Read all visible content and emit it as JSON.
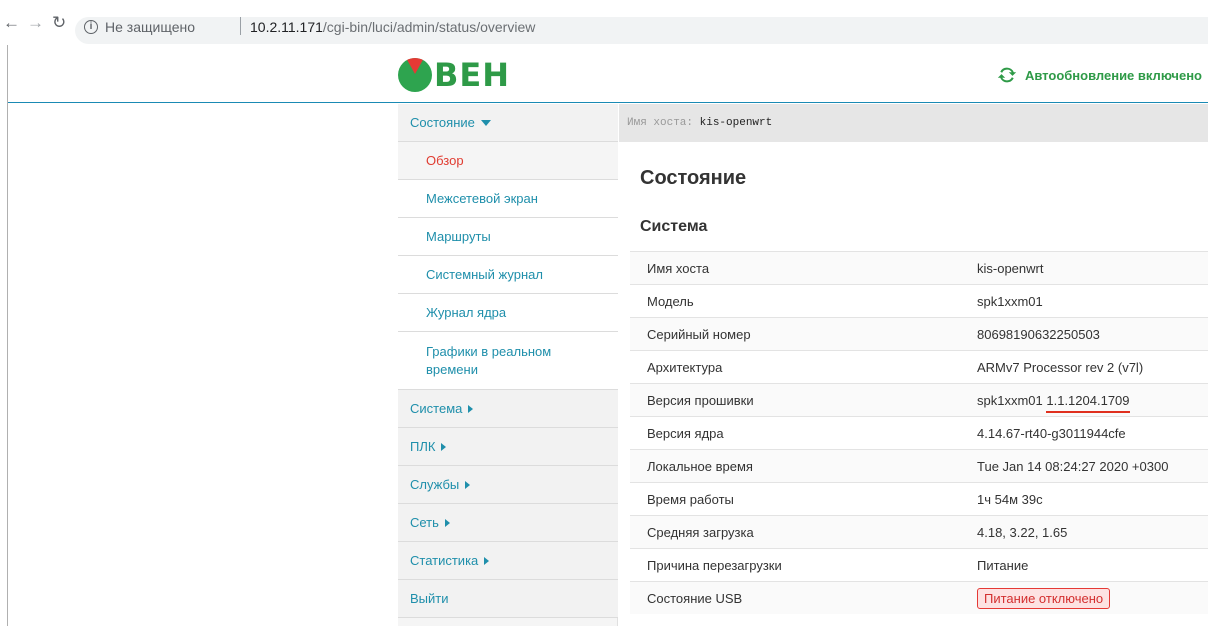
{
  "browser": {
    "secure_label": "Не защищено",
    "url_host": "10.2.11.171",
    "url_path": "/cgi-bin/luci/admin/status/overview"
  },
  "header": {
    "logo_text": "ВЕН",
    "autorefresh_label": "Автообновление включено"
  },
  "sidebar": {
    "status": "Состояние",
    "sub_items": [
      "Обзор",
      "Межсетевой экран",
      "Маршруты",
      "Системный журнал",
      "Журнал ядра"
    ],
    "realtime_line1": "Графики в реальном",
    "realtime_line2": "времени",
    "top_items": [
      "Система",
      "ПЛК",
      "Службы",
      "Сеть",
      "Статистика"
    ],
    "logout": "Выйти"
  },
  "hostbar": {
    "label": "Имя хоста:",
    "value": "kis-openwrt"
  },
  "main": {
    "title": "Состояние",
    "section": "Система",
    "rows": [
      {
        "key": "Имя хоста",
        "value": "kis-openwrt"
      },
      {
        "key": "Модель",
        "value": "spk1xxm01"
      },
      {
        "key": "Серийный номер",
        "value": "80698190632250503"
      },
      {
        "key": "Архитектура",
        "value": "ARMv7 Processor rev 2 (v7l)"
      },
      {
        "key": "Версия прошивки",
        "value_prefix": "spk1xxm01",
        "value_version": "1.1.1204.1709"
      },
      {
        "key": "Версия ядра",
        "value": "4.14.67-rt40-g3011944cfe"
      },
      {
        "key": "Локальное время",
        "value": "Tue Jan 14 08:24:27 2020 +0300"
      },
      {
        "key": "Время работы",
        "value": "1ч 54м 39с"
      },
      {
        "key": "Средняя загрузка",
        "value": "4.18, 3.22, 1.65"
      },
      {
        "key": "Причина перезагрузки",
        "value": "Питание"
      },
      {
        "key": "Состояние USB",
        "value": "Питание отключено"
      }
    ]
  },
  "colors": {
    "accent": "#1f8fab",
    "brand_green": "#2e9a47",
    "active_red": "#e03c31"
  }
}
